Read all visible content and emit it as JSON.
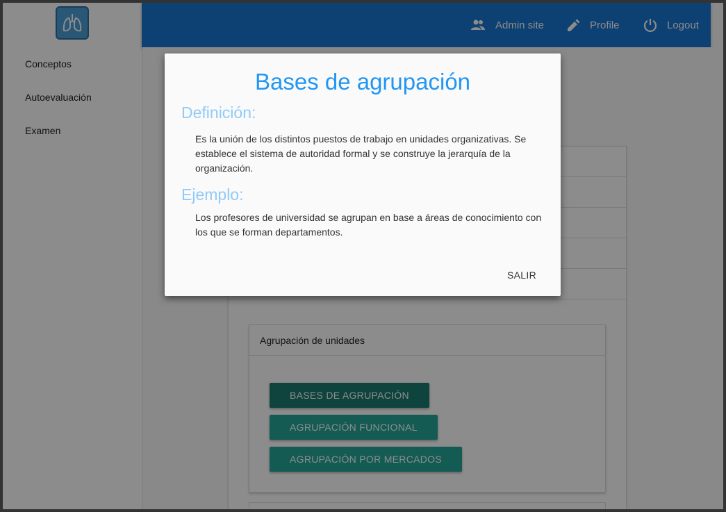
{
  "sidebar": {
    "logo_icon": "lungs-icon",
    "items": [
      {
        "label": "Conceptos"
      },
      {
        "label": "Autoevaluación"
      },
      {
        "label": "Examen"
      }
    ]
  },
  "header": {
    "actions": [
      {
        "label": "Admin site",
        "icon": "people-icon"
      },
      {
        "label": "Profile",
        "icon": "pencil-icon"
      },
      {
        "label": "Logout",
        "icon": "power-icon"
      }
    ],
    "color": "#1976d2"
  },
  "card": {
    "title": "Agrupación de unidades",
    "buttons": [
      {
        "label": "BASES DE AGRUPACIÓN",
        "active": true
      },
      {
        "label": "AGRUPACIÓN FUNCIONAL",
        "active": false
      },
      {
        "label": "AGRUPACIÓN POR MERCADOS",
        "active": false
      }
    ],
    "button_color": "#26a69a"
  },
  "modal": {
    "title": "Bases de agrupación",
    "definition_heading": "Definición:",
    "definition_text": "Es la unión de los distintos puestos de trabajo en unidades organizativas. Se establece el sistema de autoridad formal y se construye la jerarquía de la organización.",
    "example_heading": "Ejemplo:",
    "example_text": "Los profesores de universidad se agrupan en base a áreas de conocimiento con los que se forman departamentos.",
    "close_label": "SALIR",
    "title_color": "#2196f3",
    "heading_color": "#90caf9"
  }
}
